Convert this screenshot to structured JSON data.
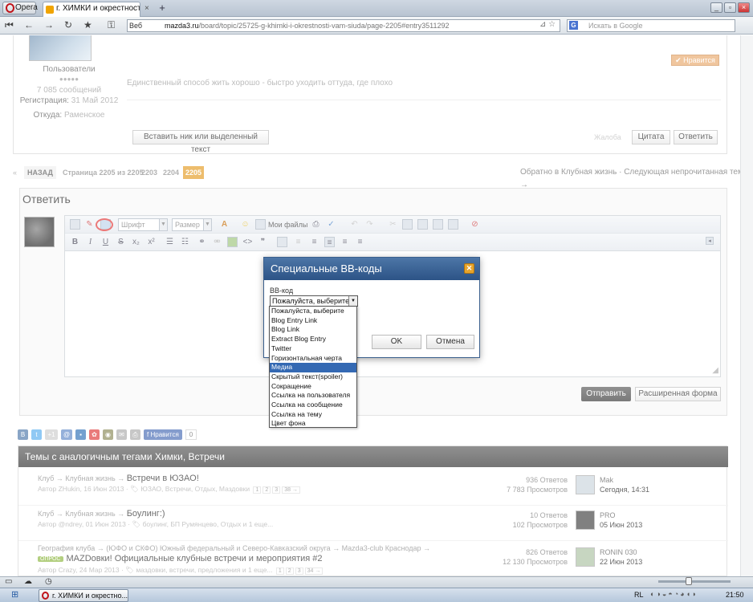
{
  "browser": {
    "menu_label": "Opera",
    "tab_title": "г. ХИМКИ и окрестност...",
    "tab_close": "×",
    "new_tab": "+",
    "address_prefix": "Веб",
    "address_host": "mazda3.ru",
    "address_path": "/board/topic/25725-g-khimki-i-okrestnosti-vam-siuda/page-2205#entry3511292",
    "search_placeholder": "Искать в Google",
    "search_engine": "G"
  },
  "post": {
    "group": "Пользователи",
    "stars": "●●●●●",
    "posts_count": "7 085 сообщений",
    "reg_label": "Регистрация:",
    "reg_date": "31 Май 2012",
    "from_label": "Откуда:",
    "from_value": "Раменское",
    "signature": "Единственный способ жить хорошо - быстро уходить оттуда, где плохо",
    "like_label": "✔ Нравится",
    "insert_nick_btn": "Вставить ник или выделенный текст",
    "complaint": "Жалоба",
    "quote_btn": "Цитата",
    "reply_btn": "Ответить"
  },
  "pagination": {
    "prev_arrow": "«",
    "back_label": "НАЗАД",
    "page_info": "Страница 2205 из 2205",
    "pages": [
      "2203",
      "2204",
      "2205"
    ],
    "back_to_forum": "Обратно в Клубная жизнь · Следующая непрочитанная тема →"
  },
  "reply": {
    "title": "Ответить",
    "font_combo": "Шрифт",
    "size_combo": "Размер",
    "my_files": "Мои файлы",
    "send_btn": "Отправить",
    "advanced_btn": "Расширенная форма"
  },
  "dialog": {
    "title": "Специальные BB-коды",
    "close": "✕",
    "label": "BB-код",
    "selected": "Пожалуйста, выберите",
    "ok": "OK",
    "cancel": "Отмена",
    "options": [
      "Пожалуйста, выберите",
      "Blog Entry Link",
      "Blog Link",
      "Extract Blog Entry",
      "Twitter",
      "Горизонтальная черта",
      "Медиа",
      "Скрытый текст(spoiler)",
      "Сокращение",
      "Ссылка на пользователя",
      "Ссылка на сообщение",
      "Ссылка на тему",
      "Цвет фона"
    ],
    "highlighted_index": 6
  },
  "share": {
    "like_label": "Нравится",
    "like_count": "0"
  },
  "similar": {
    "header": "Темы с аналогичным тегами Химки, Встречи",
    "topics": [
      {
        "crumb": "Клуб → Клубная жизнь →",
        "title": "Встречи в ЮЗАО!",
        "meta": "Автор ZHukin, 16 Июн 2013 · 🏷 ЮЗАО, Встречи, Отдых, Маздовки",
        "pages": [
          "1",
          "2",
          "3",
          "38 →"
        ],
        "replies": "936 Ответов",
        "views": "7 783 Просмотров",
        "last_user": "Mak",
        "last_time": "Сегодня, 14:31"
      },
      {
        "crumb": "Клуб → Клубная жизнь →",
        "title": "Боулинг:)",
        "meta": "Автор @ndrey, 01 Июн 2013 · 🏷 боулинг, БП Румянцево, Отдых и 1 еще...",
        "pages": [],
        "replies": "10 Ответов",
        "views": "102 Просмотров",
        "last_user": "PRO",
        "last_time": "05 Июн 2013"
      },
      {
        "crumb": "География клуба → (ЮФО и СКФО) Южный федеральный и Северо-Кавказский округа → Mazda3-club Краснодар →",
        "badge": "ОПРОС",
        "title": "MAZDовки! Официальные клубные встречи и мероприятия #2",
        "meta": "Автор Crazy, 24 Мар 2013 · 🏷 маздовки, встречи, предложения и 1 еще...",
        "pages": [
          "1",
          "2",
          "3",
          "34 →"
        ],
        "replies": "826 Ответов",
        "views": "12 130 Просмотров",
        "last_user": "RONIN 030",
        "last_time": "22 Июн 2013"
      }
    ]
  },
  "taskbar": {
    "task_label": "г. ХИМКИ и окрестно...",
    "lang": "RL",
    "clock": "21:50"
  }
}
